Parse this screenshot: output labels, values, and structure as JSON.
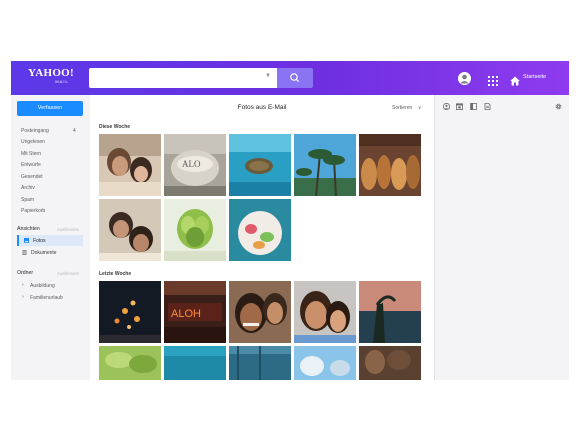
{
  "header": {
    "logo_line1": "YAHOO!",
    "logo_line2": "MAIL",
    "search": {
      "value": "",
      "placeholder": ""
    },
    "home_label": "Startseite",
    "colors": {
      "brand_start": "#5b39e8",
      "brand_end": "#8f3bf0",
      "search_button": "#8b74f4"
    },
    "icons": [
      "search-icon",
      "avatar-icon",
      "apps-grid-icon",
      "home-icon"
    ]
  },
  "sidebar": {
    "compose_label": "Verfassen",
    "folders": [
      {
        "label": "Posteingang",
        "count": "4"
      },
      {
        "label": "Ungelesen",
        "count": ""
      },
      {
        "label": "Mit Stern",
        "count": ""
      },
      {
        "label": "Entwürfe",
        "count": ""
      },
      {
        "label": "Gesendet",
        "count": ""
      },
      {
        "label": "Archiv",
        "count": ""
      },
      {
        "label": "Spam",
        "count": ""
      },
      {
        "label": "Papierkorb",
        "count": ""
      }
    ],
    "views": {
      "heading": "Ansichten",
      "action": "Ausblenden",
      "items": [
        {
          "label": "Fotos",
          "icon": "photo-icon",
          "active": true
        },
        {
          "label": "Dokumente",
          "icon": "document-icon",
          "active": false
        }
      ]
    },
    "ordner": {
      "heading": "Ordner",
      "action": "Ausblenden",
      "items": [
        {
          "label": "Ausbildung"
        },
        {
          "label": "Familienurlaub"
        }
      ]
    },
    "colors": {
      "compose": "#1a8cff",
      "active_bg": "#dde8f8"
    }
  },
  "main": {
    "title": "Fotos aus E-Mail",
    "sort_label": "Sortieren",
    "groups": [
      {
        "heading": "Diese Woche",
        "photo_count": 8
      },
      {
        "heading": "Letzte Woche",
        "photo_count": 10
      }
    ]
  },
  "rail": {
    "icons": [
      "contacts-icon",
      "calendar-icon",
      "notepad-icon",
      "document-icon",
      "settings-icon"
    ]
  }
}
